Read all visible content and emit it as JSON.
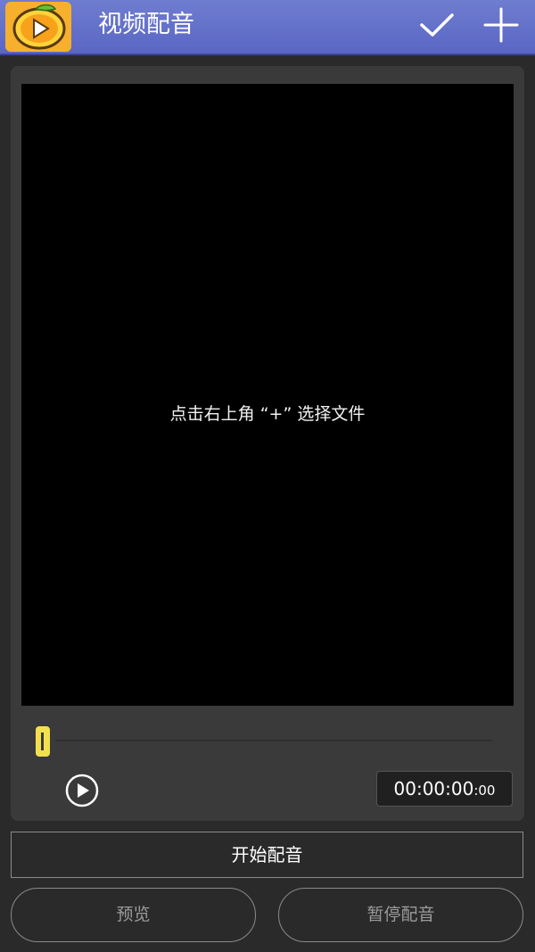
{
  "header": {
    "title": "视频配音",
    "logo_icon": "mango-play-logo-icon",
    "confirm_icon": "check-icon",
    "add_icon": "plus-icon",
    "bar_color": "#5a66c4"
  },
  "player": {
    "hint": "点击右上角 “+” 选择文件",
    "progress": 0,
    "timecode_main": "00:00:00",
    "timecode_sep": ":",
    "timecode_ms": "00",
    "thumb_color": "#f3e04f"
  },
  "actions": {
    "start_label": "开始配音",
    "preview_label": "预览",
    "pause_label": "暂停配音"
  }
}
